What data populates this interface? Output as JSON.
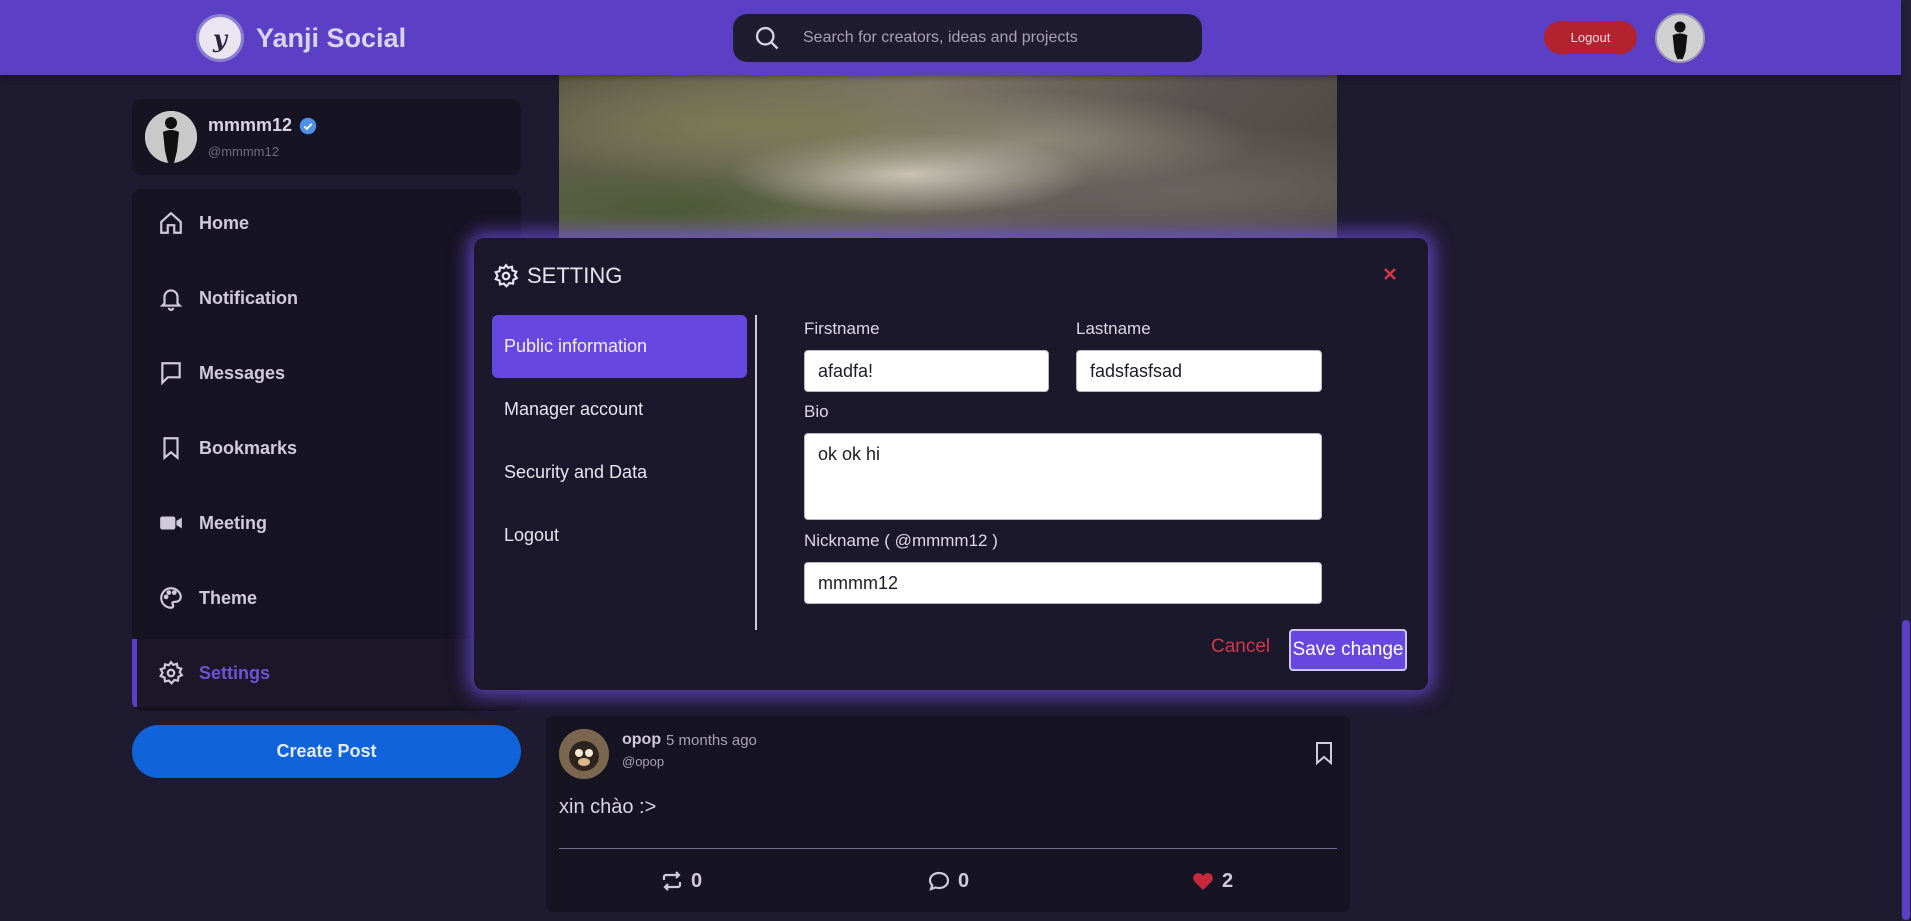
{
  "header": {
    "logo_letter": "y",
    "app_name": "Yanji Social",
    "search_placeholder": "Search for creators, ideas and projects",
    "logout_label": "Logout"
  },
  "profile": {
    "name": "mmmm12",
    "handle": "@mmmm12"
  },
  "sidebar": {
    "items": [
      {
        "label": "Home",
        "icon": "home-icon"
      },
      {
        "label": "Notification",
        "icon": "bell-icon"
      },
      {
        "label": "Messages",
        "icon": "message-icon"
      },
      {
        "label": "Bookmarks",
        "icon": "bookmark-icon"
      },
      {
        "label": "Meeting",
        "icon": "video-icon"
      },
      {
        "label": "Theme",
        "icon": "palette-icon"
      },
      {
        "label": "Settings",
        "icon": "gear-icon",
        "active": true
      }
    ],
    "create_post_label": "Create Post"
  },
  "post": {
    "author": "opop",
    "time": "5 months ago",
    "handle": "@opop",
    "text": "xin chào :>",
    "reposts": "0",
    "comments": "0",
    "likes": "2"
  },
  "modal": {
    "title": "SETTING",
    "menu": [
      {
        "label": "Public information",
        "active": true
      },
      {
        "label": "Manager account"
      },
      {
        "label": "Security and Data"
      },
      {
        "label": "Logout"
      }
    ],
    "form": {
      "firstname_label": "Firstname",
      "firstname_value": "afadfa!",
      "lastname_label": "Lastname",
      "lastname_value": "fadsfasfsad",
      "bio_label": "Bio",
      "bio_value": "ok ok hi",
      "nickname_label": "Nickname ( @mmmm12 )",
      "nickname_value": "mmmm12"
    },
    "cancel_label": "Cancel",
    "save_label": "Save change"
  },
  "colors": {
    "accent": "#5b3fc4",
    "background": "#1e1a2f",
    "danger": "#d2384b",
    "primary_button": "#1163d9"
  }
}
